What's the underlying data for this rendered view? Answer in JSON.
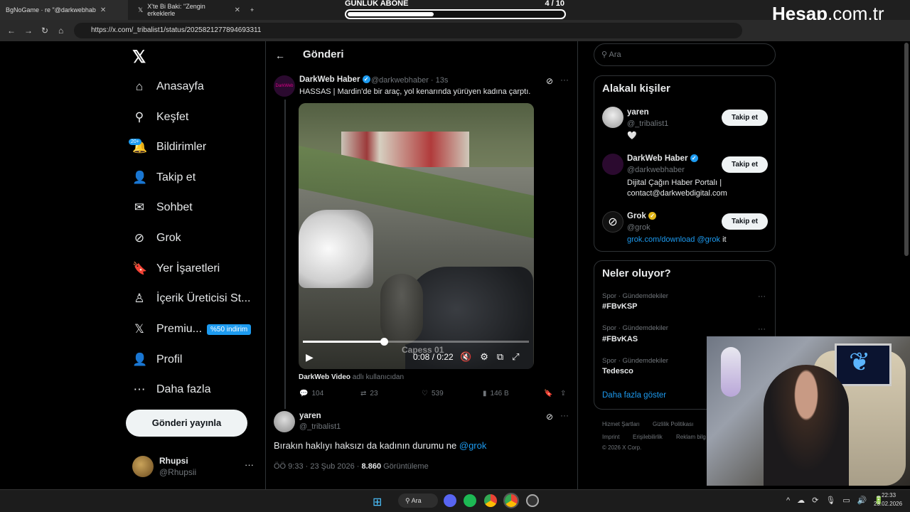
{
  "browser": {
    "tabs": [
      {
        "label": "BgNoGame · re \"@darkwebhab",
        "active": true
      },
      {
        "label": "X'te Bi Baki: \"Zengin erkeklerle",
        "active": false
      }
    ],
    "new_tab": "+",
    "url": "https://x.com/_tribalist1/status/2025821277894693311"
  },
  "overlay": {
    "sub_label": "GÜNLÜK ABONE",
    "sub_count": "4 / 10",
    "sub_progress": 0.4,
    "brand": "Hesap",
    "brand_suffix": ".com.tr"
  },
  "sidebar": {
    "items": [
      {
        "label": "Anasayfa",
        "icon": "home-icon",
        "glyph": "⌂"
      },
      {
        "label": "Keşfet",
        "icon": "search-icon",
        "glyph": "⚲"
      },
      {
        "label": "Bildirimler",
        "icon": "bell-icon",
        "glyph": "🔔"
      },
      {
        "label": "Takip et",
        "icon": "add-user-icon",
        "glyph": "👤"
      },
      {
        "label": "Sohbet",
        "icon": "mail-icon",
        "glyph": "✉"
      },
      {
        "label": "Grok",
        "icon": "grok-icon",
        "glyph": "⊘"
      },
      {
        "label": "Yer İşaretleri",
        "icon": "bookmark-icon",
        "glyph": "🔖"
      },
      {
        "label": "İçerik Üreticisi St...",
        "icon": "creator-icon",
        "glyph": "♙"
      },
      {
        "label": "Premiu...",
        "icon": "x-logo-icon",
        "glyph": "𝕏"
      },
      {
        "label": "Profil",
        "icon": "profile-icon",
        "glyph": "👤"
      },
      {
        "label": "Daha fazla",
        "icon": "more-circle-icon",
        "glyph": "⋯"
      }
    ],
    "notif_badge": "20+",
    "premium_badge": "%50 indirim",
    "post_button": "Gönderi yayınla",
    "account": {
      "name": "Rhupsi",
      "handle": "@Rhupsii",
      "more": "···"
    }
  },
  "main": {
    "header_title": "Gönderi",
    "post1": {
      "avatar_text": "DarkWeb",
      "name": "DarkWeb Haber",
      "handle_time": "@darkwebhaber · 13s",
      "text": "HASSAS | Mardin'de bir araç, yol kenarında yürüyen kadına çarptı.",
      "video": {
        "time": "0:08 / 0:22",
        "progress": 0.36,
        "watermark": "Capess 01"
      },
      "source_prefix": "DarkWeb Video",
      "source_suffix": " adlı kullanıcıdan",
      "stats": {
        "replies": "104",
        "reposts": "23",
        "likes": "539",
        "views": "146 B"
      }
    },
    "post2": {
      "name": "yaren",
      "handle": "@_tribalist1",
      "text": "Bırakın haklıyı haksızı da kadının durumu ne ",
      "mention": "@grok",
      "time": "ÖÖ 9:33 · 23 Şub 2026 · ",
      "views": "8.860",
      "views_label": " Görüntüleme"
    }
  },
  "right": {
    "search_placeholder": "Ara",
    "related_title": "Alakalı kişiler",
    "people": [
      {
        "name": "yaren",
        "handle": "@_tribalist1",
        "bio": "🤍",
        "follow": "Takip et"
      },
      {
        "name": "DarkWeb Haber",
        "handle": "@darkwebhaber",
        "bio": "Dijital Çağın Haber Portalı | contact@darkwebdigital.com",
        "follow": "Takip et"
      },
      {
        "name": "Grok",
        "handle": "@grok",
        "bio_link": "grok.com/download @grok",
        "bio_tail": " it",
        "follow": "Takip et"
      }
    ],
    "trends_title": "Neler oluyor?",
    "trends": [
      {
        "category": "Spor · Gündemdekiler",
        "name": "#FBvKSP"
      },
      {
        "category": "Spor · Gündemdekiler",
        "name": "#FBvKAS"
      },
      {
        "category": "Spor · Gündemdekiler",
        "name": "Tedesco"
      }
    ],
    "show_more": "Daha fazla göster",
    "footer": [
      "Hizmet Şartları",
      "Gizlilik Politikası",
      "Imprint",
      "Erişilebilirlik",
      "Reklam bilg",
      "© 2026 X Corp."
    ]
  },
  "taskbar": {
    "search": "Ara",
    "time": "22:33",
    "date": "23.02.2026"
  }
}
